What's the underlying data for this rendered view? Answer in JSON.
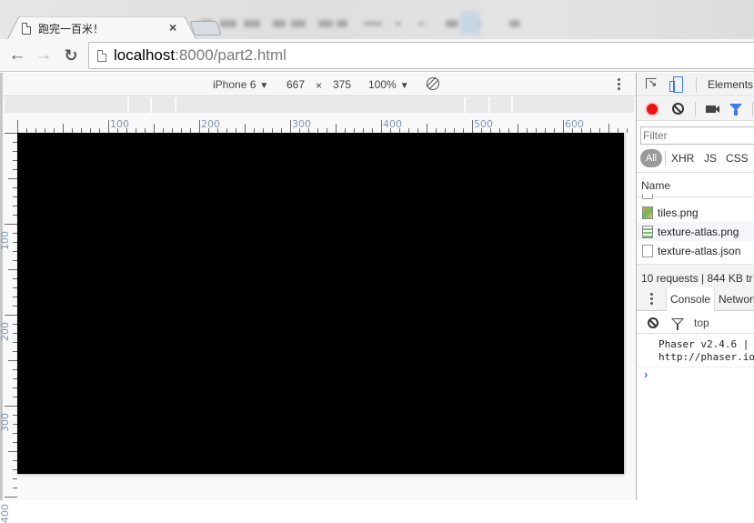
{
  "browser": {
    "tab": {
      "title": "跑完一百米！",
      "close_glyph": "×"
    },
    "nav": {
      "back_glyph": "←",
      "forward_glyph": "→",
      "reload_glyph": "↻"
    },
    "address": {
      "host": "localhost",
      "rest": ":8000/part2.html"
    }
  },
  "device_toolbar": {
    "device": "iPhone 6",
    "width": "667",
    "times": "×",
    "height": "375",
    "zoom": "100%",
    "caret": "▼"
  },
  "rulers": {
    "horizontal_labels": [
      "100",
      "200",
      "300",
      "400",
      "500",
      "600"
    ],
    "vertical_labels": [
      "100",
      "200",
      "300",
      "400"
    ]
  },
  "devtools": {
    "top_tab": "Elements",
    "filter_placeholder": "Filter",
    "type_filters": [
      "All",
      "XHR",
      "JS",
      "CSS"
    ],
    "column_header": "Name",
    "requests": [
      {
        "name": "tiles.png",
        "icon": "image-file-icon"
      },
      {
        "name": "texture-atlas.png",
        "icon": "image-file-icon"
      },
      {
        "name": "texture-atlas.json",
        "icon": "document-file-icon"
      }
    ],
    "summary": "10 requests | 844 KB tr",
    "drawer_tabs": [
      "Console",
      "Network"
    ],
    "console_context": "top",
    "console_message_line1": "Phaser v2.4.6 |",
    "console_message_line2": "http://phaser.io",
    "prompt_glyph": "›"
  }
}
